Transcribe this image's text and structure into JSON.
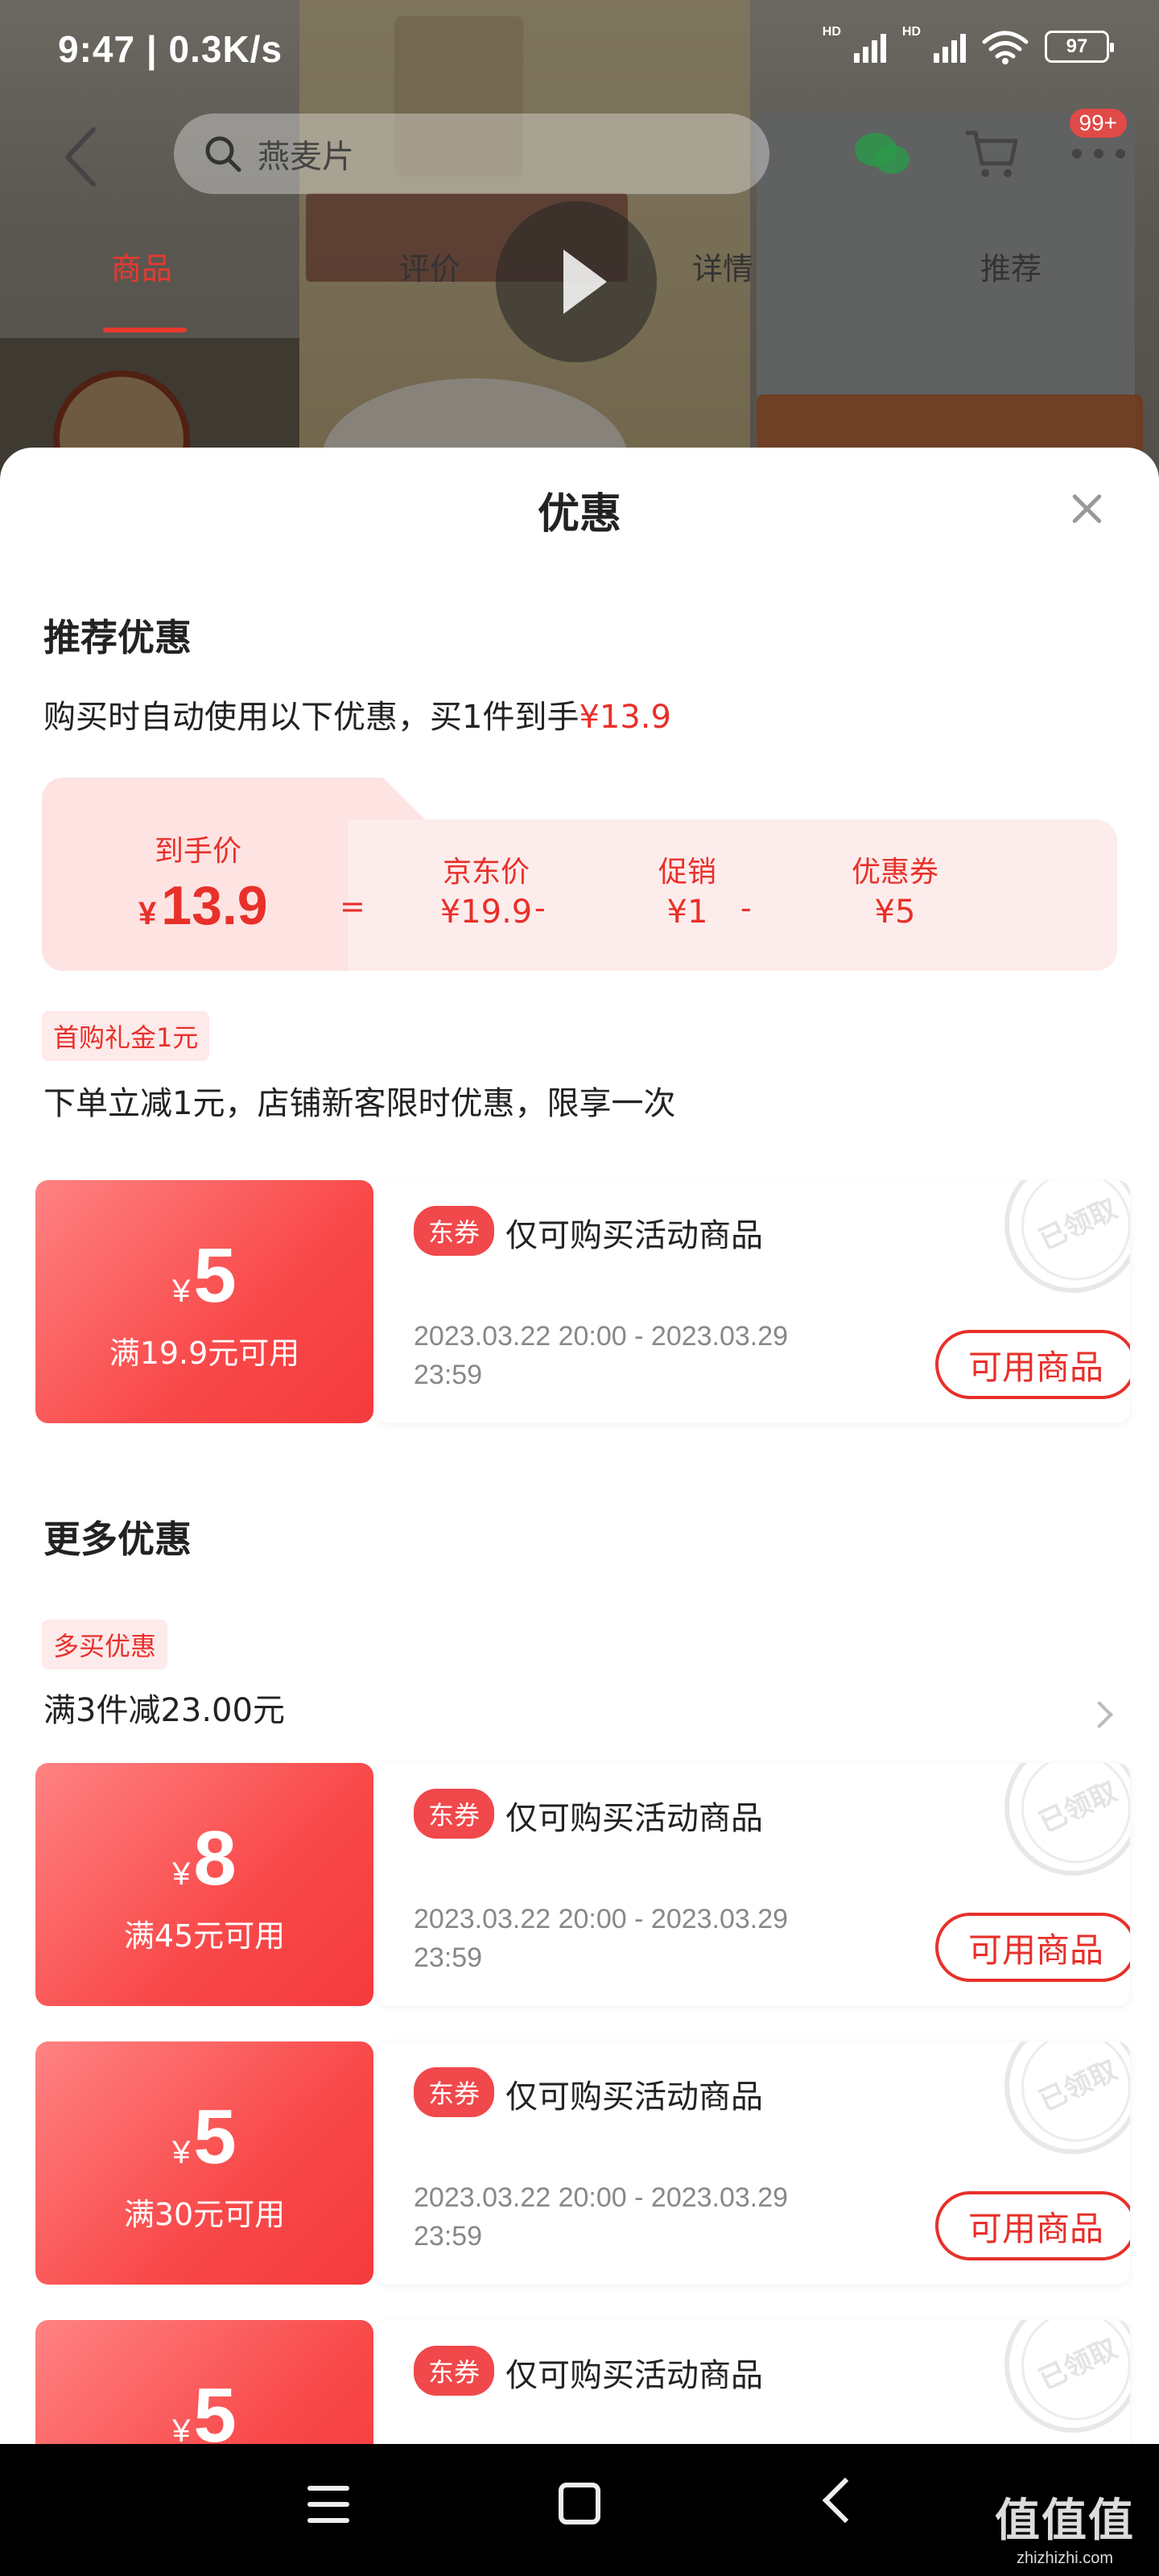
{
  "status_bar": {
    "time": "9:47 | 0.3K/s",
    "hd1": "HD",
    "hd2": "HD",
    "battery": "97"
  },
  "nav": {
    "search_placeholder": "燕麦片",
    "cart_badge": "99+"
  },
  "tabs": [
    {
      "label": "商品",
      "active": true
    },
    {
      "label": "评价",
      "active": false
    },
    {
      "label": "详情",
      "active": false
    },
    {
      "label": "推荐",
      "active": false
    }
  ],
  "sheet": {
    "title": "优惠",
    "recommended": {
      "title": "推荐优惠",
      "summary_prefix": "购买时自动使用以下优惠，买1件到手",
      "summary_price": "¥13.9",
      "final_label": "到手价",
      "final_yen": "¥",
      "final_value": "13.9",
      "eq": "=",
      "jd_label": "京东价",
      "jd_value": "¥19.9",
      "minus1": "-",
      "promo_label": "促销",
      "promo_value": "¥1",
      "minus2": "-",
      "coupon_label": "优惠券",
      "coupon_value": "¥5"
    },
    "first_buy": {
      "tag": "首购礼金1元",
      "desc": "下单立减1元，店铺新客限时优惠，限享一次"
    },
    "coupons_top": [
      {
        "yen": "¥",
        "amount": "5",
        "condition": "满19.9元可用",
        "badge": "东券",
        "desc": "仅可购买活动商品",
        "date_line1": "2023.03.22 20:00 - 2023.03.29",
        "date_line2": "23:59",
        "button": "可用商品",
        "stamp": "已领取"
      }
    ],
    "more": {
      "title": "更多优惠",
      "tag": "多买优惠",
      "desc": "满3件减23.00元"
    },
    "coupons_more": [
      {
        "yen": "¥",
        "amount": "8",
        "condition": "满45元可用",
        "badge": "东券",
        "desc": "仅可购买活动商品",
        "date_line1": "2023.03.22 20:00 - 2023.03.29",
        "date_line2": "23:59",
        "button": "可用商品",
        "stamp": "已领取"
      },
      {
        "yen": "¥",
        "amount": "5",
        "condition": "满30元可用",
        "badge": "东券",
        "desc": "仅可购买活动商品",
        "date_line1": "2023.03.22 20:00 - 2023.03.29",
        "date_line2": "23:59",
        "button": "可用商品",
        "stamp": "已领取"
      },
      {
        "yen": "¥",
        "amount": "5",
        "condition": "",
        "badge": "东券",
        "desc": "仅可购买活动商品",
        "date_line1": "",
        "date_line2": "",
        "button": "",
        "stamp": "已领取"
      }
    ]
  },
  "watermark": {
    "line1": "值值值",
    "line2": "zhizhizhi.com"
  },
  "colors": {
    "accent": "#e8302a",
    "coupon_red": "#f9494a",
    "sheet_bg": "#ffffff"
  }
}
